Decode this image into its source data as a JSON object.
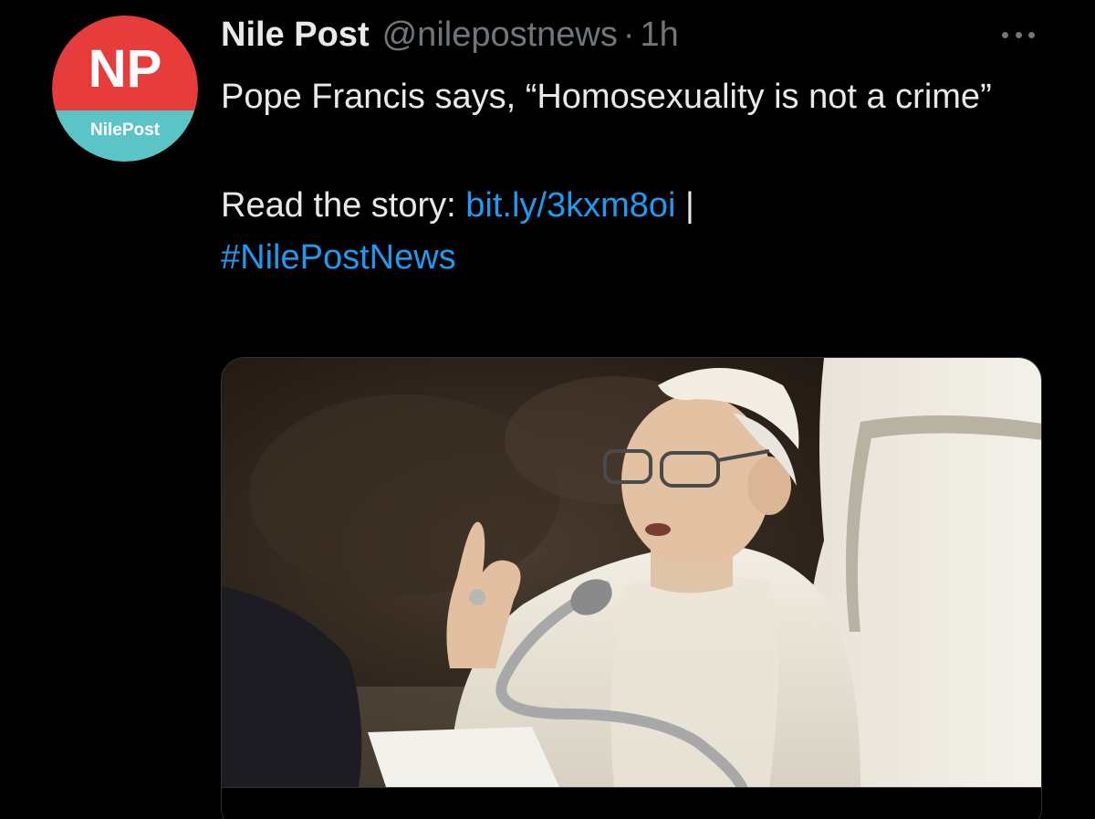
{
  "tweet": {
    "avatar": {
      "monogram": "NP",
      "label": "NilePost",
      "top_color": "#e63c3c",
      "bottom_color": "#5bc4c6"
    },
    "display_name": "Nile Post",
    "handle": "@nilepostnews",
    "separator": "·",
    "time": "1h",
    "text_line1": "Pope Francis says, “Homosexuality is not a crime”",
    "read_prefix": "Read the story: ",
    "link": "bit.ly/3kxm8oi",
    "pipe": " |",
    "hashtag": "#NilePostNews"
  },
  "colors": {
    "background": "#000000",
    "text": "#e7e9ea",
    "muted": "#71767b",
    "link": "#1d9bf0"
  },
  "icons": {
    "more": "more-horizontal-icon"
  }
}
